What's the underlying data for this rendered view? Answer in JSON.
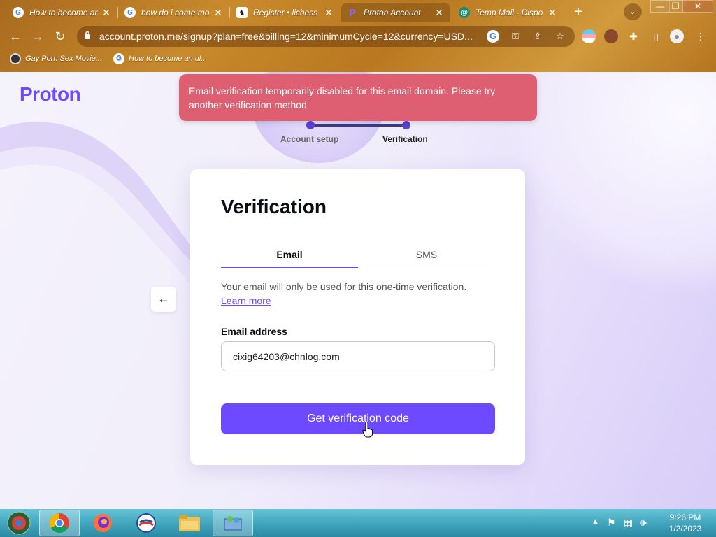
{
  "browser": {
    "tabs": [
      {
        "title": "How to become an",
        "favicon": "google-icon"
      },
      {
        "title": "how do i come mod",
        "favicon": "google-icon"
      },
      {
        "title": "Register • lichess",
        "favicon": "lichess-icon"
      },
      {
        "title": "Proton Account",
        "favicon": "proton-icon",
        "active": true
      },
      {
        "title": "Temp Mail - Dispo",
        "favicon": "tempmail-icon"
      }
    ],
    "url": "account.proton.me/signup?plan=free&billing=12&minimumCycle=12&currency=USD...",
    "bookmarks": [
      {
        "title": "Gay Porn Sex Movie...",
        "favicon": "bookmark-site-icon"
      },
      {
        "title": "How to become an ul...",
        "favicon": "google-icon"
      }
    ]
  },
  "page": {
    "logo": "Proton",
    "toast": "Email verification temporarily disabled for this email domain. Please try another verification method",
    "steps": [
      "Account setup",
      "Verification"
    ],
    "card": {
      "title": "Verification",
      "tabs": {
        "email": "Email",
        "sms": "SMS"
      },
      "helper_text": "Your email will only be used for this one-time verification.",
      "learn_more": "Learn more",
      "email_label": "Email address",
      "email_value": "cixig64203@chnlog.com",
      "cta": "Get verification code"
    },
    "back_icon": "arrow-left-icon"
  },
  "taskbar": {
    "time": "9:26 PM",
    "date": "1/2/2023"
  },
  "colors": {
    "accent": "#6d4aff",
    "toast": "#df5f72",
    "chrome_frame": "#c88a2c",
    "taskbar": "#3fa3bb"
  }
}
